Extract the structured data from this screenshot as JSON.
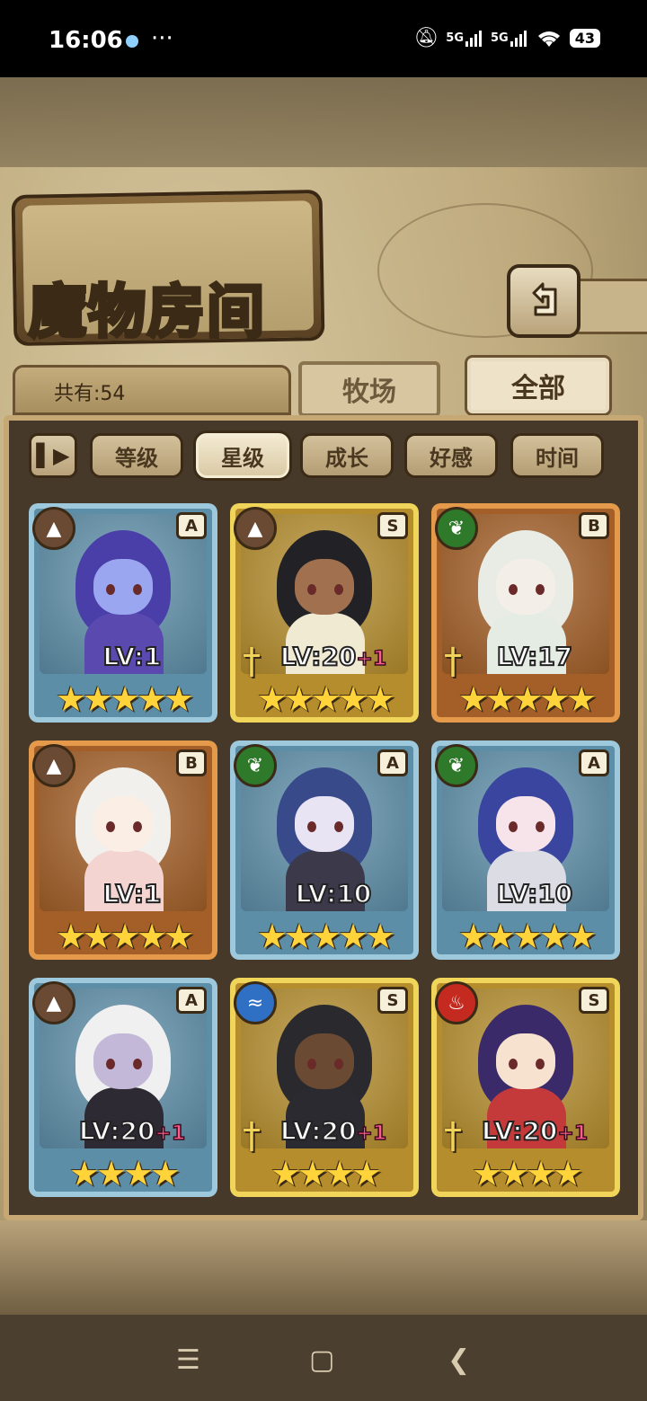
{
  "status_bar": {
    "time": "16:06",
    "dots": "···",
    "signal1": "5G",
    "signal2": "5G",
    "battery": "43"
  },
  "page": {
    "title": "魔物房间",
    "count_label": "共有:54"
  },
  "tabs": [
    {
      "label": "牧场"
    },
    {
      "label": "全部"
    }
  ],
  "sort": {
    "toggle": "▌▶",
    "buttons": [
      {
        "label": "等级"
      },
      {
        "label": "星级"
      },
      {
        "label": "成长"
      },
      {
        "label": "好感"
      },
      {
        "label": "时间"
      }
    ],
    "active": "星级"
  },
  "monsters": [
    {
      "rank": "A",
      "element": "earth",
      "level": "LV:1",
      "plus": "",
      "stars": "★★★★★",
      "frame": "blue"
    },
    {
      "rank": "S",
      "element": "earth",
      "level": "LV:20",
      "plus": "+1",
      "stars": "★★★★★",
      "frame": "gold"
    },
    {
      "rank": "B",
      "element": "nature",
      "level": "LV:17",
      "plus": "",
      "stars": "★★★★★",
      "frame": "bronze"
    },
    {
      "rank": "B",
      "element": "earth",
      "level": "LV:1",
      "plus": "",
      "stars": "★★★★★",
      "frame": "bronze"
    },
    {
      "rank": "A",
      "element": "nature",
      "level": "LV:10",
      "plus": "",
      "stars": "★★★★★",
      "frame": "blue"
    },
    {
      "rank": "A",
      "element": "nature",
      "level": "LV:10",
      "plus": "",
      "stars": "★★★★★",
      "frame": "blue"
    },
    {
      "rank": "A",
      "element": "earth",
      "level": "LV:20",
      "plus": "+1",
      "stars": "★★★★",
      "frame": "blue"
    },
    {
      "rank": "S",
      "element": "water",
      "level": "LV:20",
      "plus": "+1",
      "stars": "★★★★",
      "frame": "gold"
    },
    {
      "rank": "S",
      "element": "fire",
      "level": "LV:20",
      "plus": "+1",
      "stars": "★★★★",
      "frame": "gold"
    }
  ],
  "icons": {
    "earth": "mountain-icon",
    "nature": "leaf-icon",
    "water": "wave-icon",
    "fire": "flame-icon",
    "back": "return-arrow-icon"
  },
  "colors": {
    "earth": "#6b4a33",
    "nature": "#2f7a2a",
    "water": "#2f6fc4",
    "fire": "#c42a1f"
  },
  "nav": {
    "menu": "☰",
    "home": "▢",
    "back": "❮"
  }
}
